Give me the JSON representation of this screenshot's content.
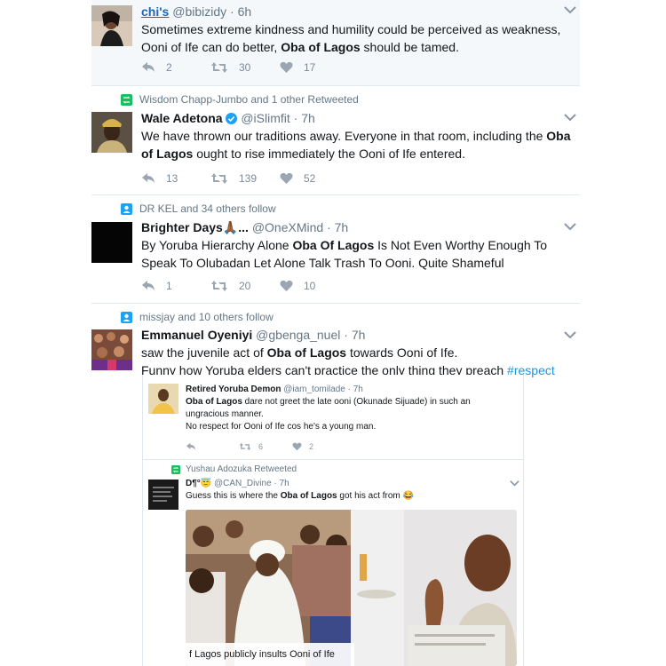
{
  "tweets": [
    {
      "name": "chi's",
      "handle": "@bibizidy",
      "time": "6h",
      "text_parts": [
        "Sometimes extreme kindness and humility could be perceived as weakness,",
        "Ooni of Ife can do better, ",
        "Oba of Lagos",
        "  should be tamed."
      ],
      "replies": "2",
      "retweets": "30",
      "likes": "17"
    },
    {
      "context": "Wisdom Chapp-Jumbo and 1 other Retweeted",
      "name": "Wale Adetona",
      "handle": "@iSlimfit",
      "time": "7h",
      "text_parts": [
        "We have thrown our traditions away. Everyone in that room, including the ",
        "Oba of Lagos",
        " ought to rise immediately the Ooni of Ife entered."
      ],
      "replies": "13",
      "retweets": "139",
      "likes": "52"
    },
    {
      "context": "DR KEL and 34 others follow",
      "name": "Brighter Days🙏🏾...",
      "handle": "@OneXMind",
      "time": "7h",
      "text_parts": [
        "By Yoruba Hierarchy Alone ",
        "Oba Of Lagos",
        " Is Not Even Worthy Enough To Speak To Olubadan Let Alone Talk Trash To Ooni. Quite Shameful"
      ],
      "replies": "1",
      "retweets": "20",
      "likes": "10"
    },
    {
      "context": "missjay and 10 others follow",
      "name": "Emmanuel Oyeniyi",
      "handle": "@gbenga_nuel",
      "time": "7h",
      "text_parts": [
        "saw the juvenile act of ",
        "Oba of Lagos",
        " towards Ooni of Ife.",
        "Funny how Yoruba elders can't practice the only thing they preach ",
        "#respect"
      ]
    }
  ],
  "quotes": [
    {
      "name": "Retired Yoruba Demon",
      "handle": "@iam_tomilade",
      "time": "7h",
      "text_parts": [
        "Oba of Lagos",
        " dare not greet the late ooni (Okunade Sijuade) in such an ungracious manner.",
        "No respect for Ooni of Ife cos he's a young man."
      ],
      "retweets": "6",
      "likes": "2"
    },
    {
      "context": "Yushau Adozuka Retweeted",
      "name": "D¶°😇",
      "handle": "@CAN_Divine",
      "time": "7h",
      "text_parts": [
        "Guess this is where the ",
        "Oba of Lagos",
        " got his act from 😂"
      ],
      "media_caption": "f Lagos publicly insults Ooni of Ife"
    }
  ],
  "colors": {
    "accent_blue": "#1b95e0",
    "retweet_green": "#17bf63",
    "muted_gray": "#657786"
  },
  "icons": [
    "reply-icon",
    "retweet-icon",
    "like-icon",
    "verified-badge-icon",
    "chevron-down-icon",
    "retweet-context-icon",
    "follow-context-icon"
  ]
}
